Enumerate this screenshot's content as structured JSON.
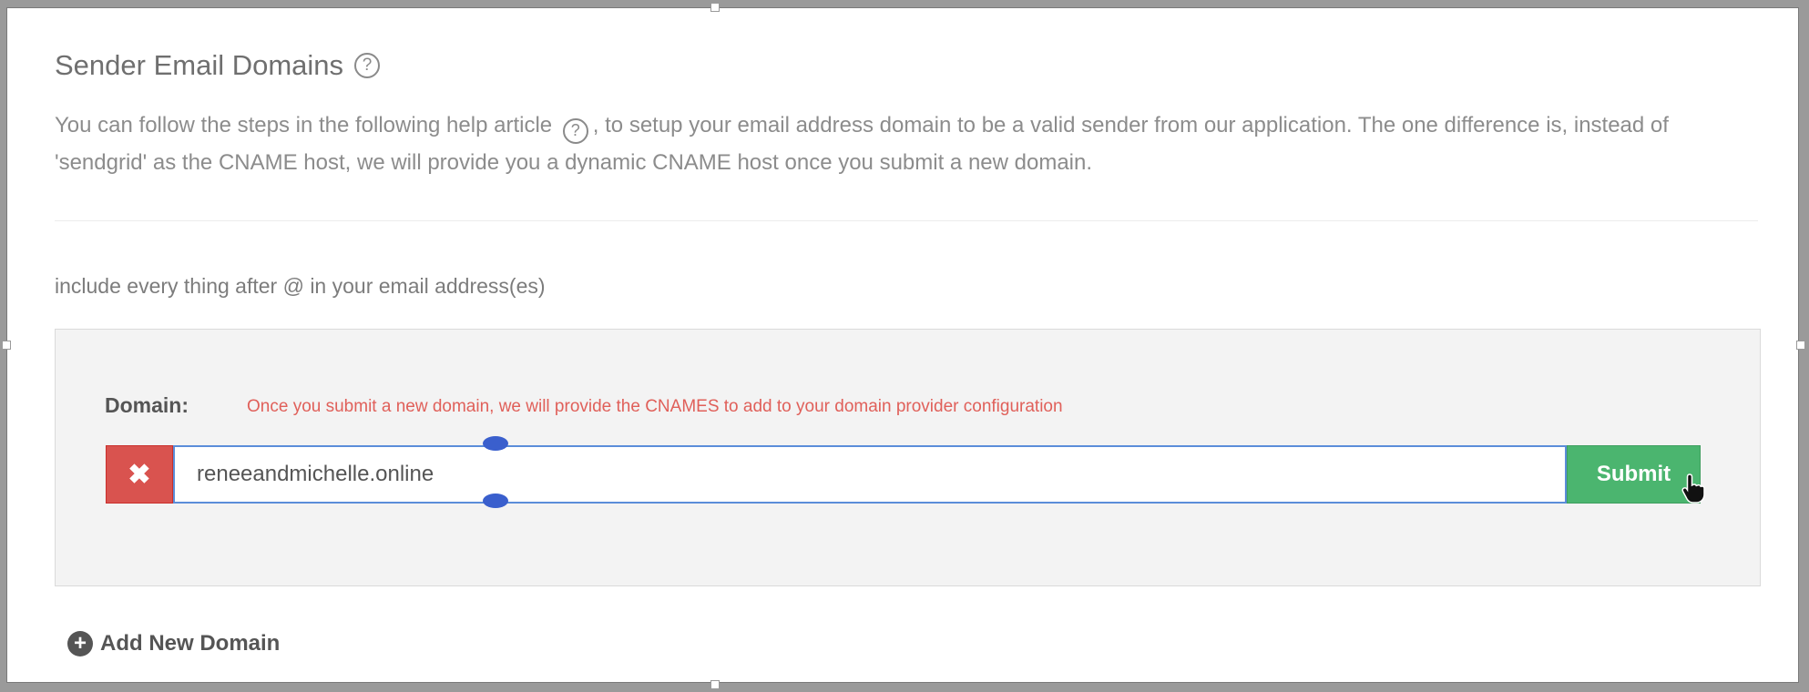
{
  "section": {
    "title": "Sender Email Domains",
    "description_before": "You can follow the steps in the following help article",
    "description_after": ", to setup your email address domain to be a valid sender from our application. The one difference is, instead of 'sendgrid' as the CNAME host, we will provide you a dynamic CNAME host once you submit a new domain.",
    "help_glyph": "?",
    "hint": "include every thing after @ in your email address(es)"
  },
  "domain_form": {
    "label": "Domain:",
    "note": "Once you submit a new domain, we will provide the CNAMES to add to your domain provider configuration",
    "input_value": "reneeandmichelle.online",
    "remove_glyph": "✖",
    "submit_label": "Submit"
  },
  "add_domain": {
    "icon_glyph": "+",
    "label": "Add New Domain"
  },
  "colors": {
    "remove": "#d9534f",
    "submit": "#4bb56f",
    "note": "#e0605a",
    "input_border": "#5b8dd9"
  }
}
